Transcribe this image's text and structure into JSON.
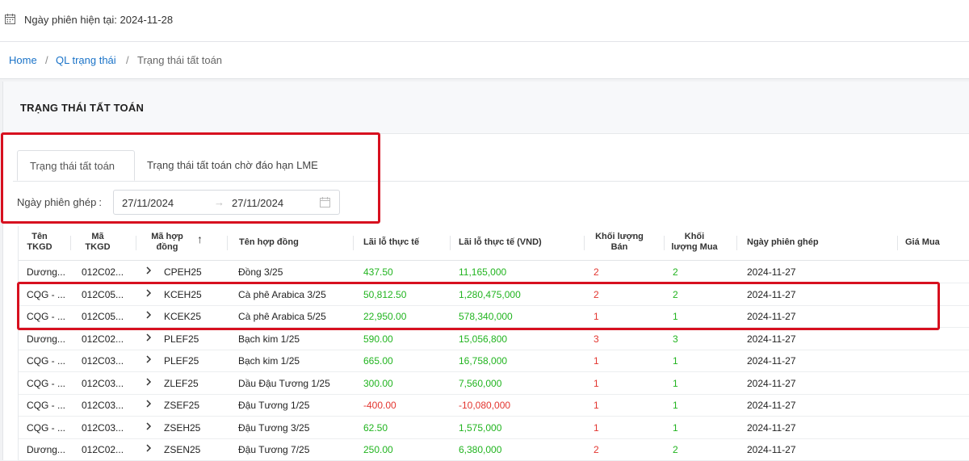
{
  "header": {
    "session_label": "Ngày phiên hiện tại: 2024-11-28",
    "calendar_icon": "calendar-icon"
  },
  "breadcrumb": {
    "home": "Home",
    "parent": "QL trạng thái",
    "current": "Trạng thái tất toán",
    "separator": "/"
  },
  "card": {
    "title": "TRẠNG THÁI TẤT TOÁN"
  },
  "tabs": [
    {
      "label": "Trạng thái tất toán",
      "active": true
    },
    {
      "label": "Trạng thái tất toán chờ đáo hạn LME",
      "active": false
    }
  ],
  "filter": {
    "label": "Ngày phiên ghép",
    "colon": ":",
    "date_from": "27/11/2024",
    "date_to": "27/11/2024",
    "arrow": "→"
  },
  "table": {
    "columns": {
      "ten_tkgd_1": "Tên",
      "ten_tkgd_2": "TKGD",
      "ma_tkgd_1": "Mã",
      "ma_tkgd_2": "TKGD",
      "ma_hop_dong_1": "Mã hợp",
      "ma_hop_dong_2": "đồng",
      "sort_arrow": "↑",
      "ten_hop_dong": "Tên hợp đồng",
      "lai_lo": "Lãi lỗ thực tế",
      "lai_lo_vnd": "Lãi lỗ thực tế (VND)",
      "kl_ban_1": "Khối lượng",
      "kl_ban_2": "Bán",
      "kl_mua_1": "Khối",
      "kl_mua_2": "lượng Mua",
      "ngay_phien": "Ngày phiên ghép",
      "gia_mua": "Giá Mua"
    },
    "rows": [
      {
        "ten": "Dương...",
        "ma": "012C02...",
        "hop_dong": "CPEH25",
        "ten_hd": "Đồng 3/25",
        "lai_lo": "437.50",
        "lai_lo_vnd": "11,165,000",
        "kl_ban": "2",
        "kl_mua": "2",
        "ngay": "2024-11-27"
      },
      {
        "ten": "CQG - ...",
        "ma": "012C05...",
        "hop_dong": "KCEH25",
        "ten_hd": "Cà phê Arabica 3/25",
        "lai_lo": "50,812.50",
        "lai_lo_vnd": "1,280,475,000",
        "kl_ban": "2",
        "kl_mua": "2",
        "ngay": "2024-11-27"
      },
      {
        "ten": "CQG - ...",
        "ma": "012C05...",
        "hop_dong": "KCEK25",
        "ten_hd": "Cà phê Arabica 5/25",
        "lai_lo": "22,950.00",
        "lai_lo_vnd": "578,340,000",
        "kl_ban": "1",
        "kl_mua": "1",
        "ngay": "2024-11-27"
      },
      {
        "ten": "Dương...",
        "ma": "012C02...",
        "hop_dong": "PLEF25",
        "ten_hd": "Bạch kim 1/25",
        "lai_lo": "590.00",
        "lai_lo_vnd": "15,056,800",
        "kl_ban": "3",
        "kl_mua": "3",
        "ngay": "2024-11-27"
      },
      {
        "ten": "CQG - ...",
        "ma": "012C03...",
        "hop_dong": "PLEF25",
        "ten_hd": "Bạch kim 1/25",
        "lai_lo": "665.00",
        "lai_lo_vnd": "16,758,000",
        "kl_ban": "1",
        "kl_mua": "1",
        "ngay": "2024-11-27"
      },
      {
        "ten": "CQG - ...",
        "ma": "012C03...",
        "hop_dong": "ZLEF25",
        "ten_hd": "Dầu Đậu Tương 1/25",
        "lai_lo": "300.00",
        "lai_lo_vnd": "7,560,000",
        "kl_ban": "1",
        "kl_mua": "1",
        "ngay": "2024-11-27"
      },
      {
        "ten": "CQG - ...",
        "ma": "012C03...",
        "hop_dong": "ZSEF25",
        "ten_hd": "Đậu Tương 1/25",
        "lai_lo": "-400.00",
        "lai_lo_vnd": "-10,080,000",
        "kl_ban": "1",
        "kl_mua": "1",
        "ngay": "2024-11-27"
      },
      {
        "ten": "CQG - ...",
        "ma": "012C03...",
        "hop_dong": "ZSEH25",
        "ten_hd": "Đậu Tương 3/25",
        "lai_lo": "62.50",
        "lai_lo_vnd": "1,575,000",
        "kl_ban": "1",
        "kl_mua": "1",
        "ngay": "2024-11-27"
      },
      {
        "ten": "Dương...",
        "ma": "012C02...",
        "hop_dong": "ZSEN25",
        "ten_hd": "Đậu Tương 7/25",
        "lai_lo": "250.00",
        "lai_lo_vnd": "6,380,000",
        "kl_ban": "2",
        "kl_mua": "2",
        "ngay": "2024-11-27"
      }
    ]
  },
  "colors": {
    "link": "#1a73c8",
    "profit": "#21b41f",
    "loss": "#e3352f",
    "highlight_border": "#d7101f"
  }
}
